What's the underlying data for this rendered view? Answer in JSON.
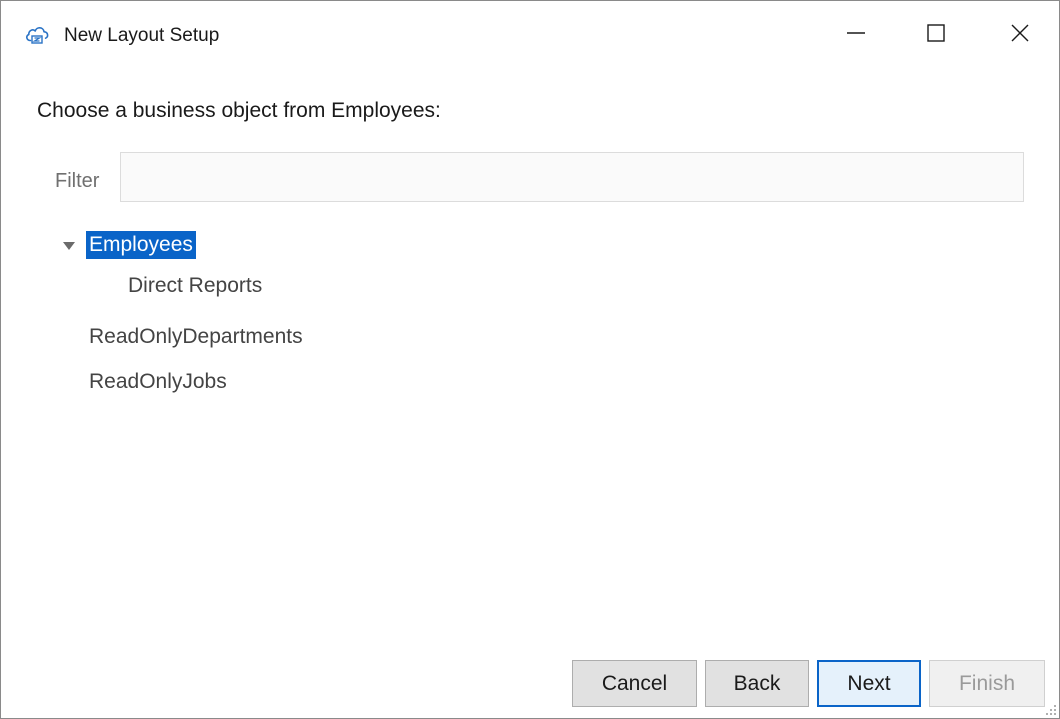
{
  "window": {
    "title": "New Layout Setup",
    "app_icon": "cloud-icon",
    "controls": {
      "minimize_icon": "minimize-icon",
      "maximize_icon": "maximize-icon",
      "close_icon": "close-icon"
    }
  },
  "main": {
    "prompt": "Choose a business object from Employees:",
    "filter": {
      "label": "Filter",
      "value": "",
      "placeholder": ""
    },
    "tree": {
      "nodes": [
        {
          "label": "Employees",
          "expanded": true,
          "selected": true
        },
        {
          "label": "Direct Reports"
        },
        {
          "label": "ReadOnlyDepartments"
        },
        {
          "label": "ReadOnlyJobs"
        }
      ]
    }
  },
  "footer": {
    "cancel_label": "Cancel",
    "back_label": "Back",
    "next_label": "Next",
    "finish_label": "Finish"
  },
  "colors": {
    "selection": "#0a64c8",
    "default_button_border": "#0a64c8",
    "disabled_text": "#9a9a9a"
  }
}
